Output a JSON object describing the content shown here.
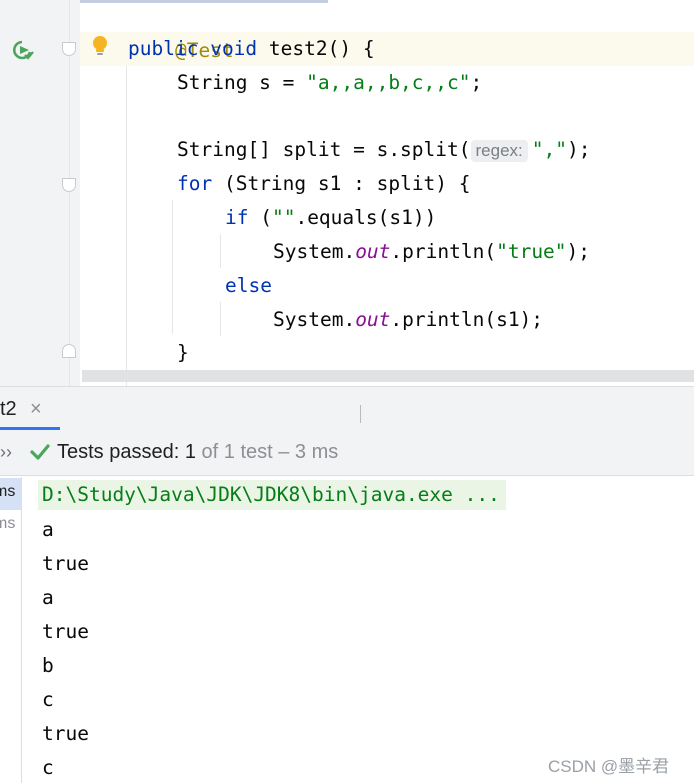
{
  "editor": {
    "lines": {
      "annotation": "@Test",
      "signature": {
        "kw1": "public",
        "kw2": "void",
        "name": " test2() {"
      },
      "assign": {
        "lhs": "String s = ",
        "value": "\"a,,a,,b,c,,c\"",
        "end": ";"
      },
      "split": {
        "lhs": "String[] split = s.split(",
        "hint": "regex:",
        "arg": "\",\"",
        "end": ");"
      },
      "for_loop": {
        "kw": "for",
        "rest": " (String s1 : split) {"
      },
      "if_line": {
        "kw": "if",
        "open": " (",
        "lit": "\"\"",
        "rest": ".equals(s1))"
      },
      "print_true": {
        "cls": "System.",
        "field": "out",
        "call": ".println(",
        "lit": "\"true\"",
        "end": ");"
      },
      "else_line": "else",
      "print_s1": {
        "cls": "System.",
        "field": "out",
        "call": ".println(s1);"
      },
      "close_brace": "}"
    }
  },
  "run_panel": {
    "tab": {
      "label": "t2",
      "close": "×"
    },
    "status": {
      "chevron": "››",
      "prefix": "Tests passed: ",
      "passed": "1",
      "suffix": " of 1 test – 3 ms"
    },
    "tree": {
      "selected_item": "ms",
      "second_item": "ms"
    },
    "console": {
      "command": "D:\\Study\\Java\\JDK\\JDK8\\bin\\java.exe ...",
      "output": [
        "a",
        "true",
        "a",
        "true",
        "b",
        "c",
        "true",
        "c"
      ]
    }
  },
  "watermark": "CSDN @墨辛君",
  "colors": {
    "keyword": "#0033b3",
    "string": "#067d17",
    "annotation": "#9e880d",
    "static_field": "#871094",
    "pass_check": "#4aa65c"
  },
  "icons": [
    "run-test-icon",
    "intention-bulb-icon",
    "check-icon",
    "close-icon"
  ]
}
